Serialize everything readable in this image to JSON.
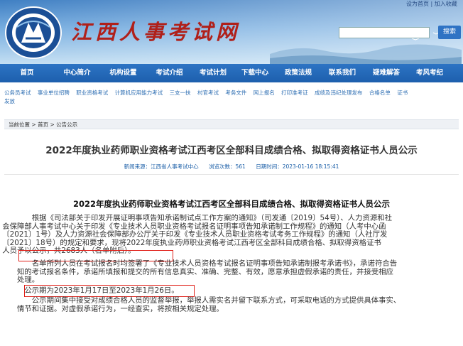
{
  "header": {
    "site_title": "江西人事考试网",
    "top_links": [
      "设为首页",
      "|",
      "加入收藏"
    ],
    "search": {
      "placeholder": "",
      "button_label": "搜索"
    }
  },
  "nav": {
    "items": [
      "首页",
      "中心简介",
      "机构设置",
      "考试介绍",
      "考试计划",
      "下载中心",
      "政策法规",
      "联系我们",
      "疑难解答",
      "考风考纪"
    ]
  },
  "subnav": {
    "items": [
      "公务员考试",
      "事业单位招聘",
      "职业资格考试",
      "计算机应用能力考试",
      "三支一扶",
      "村官考试",
      "考务文件",
      "网上报名",
      "打印准考证",
      "成绩及违纪处理发布",
      "合格名单",
      "证书",
      "发放"
    ]
  },
  "breadcrumb": {
    "prefix": "当前位置",
    "items": [
      "首页",
      "公告公示"
    ],
    "separator": ">"
  },
  "article": {
    "title": "2022年度执业药师职业资格考试江西考区全部科目成绩合格、拟取得资格证书人员公示",
    "meta": {
      "source": "新闻来源：江西省人事考试中心",
      "views": "浏览次数：561",
      "date": "日期时间：2023-01-16 18:15:41"
    },
    "content_title": "2022年度执业药师职业资格考试江西考区全部科目成绩合格、拟取得资格证书人员公示",
    "p1_lines": [
      "根据《司法部关于印发开展证明事项告知承诺制试点工作方案的通知》（司发通〔2019〕54号）、人力资源和社",
      "会保障部人事考试中心关于印发《专业技术人员职业资格考试报名证明事项告知承诺制工作规程》的通知（人考中心函",
      "〔2021〕1号）及人力资源社会保障部办公厅关于印发《专业技术人员职业资格考试考务工作规程》的通知（人社厅发",
      "〔2021〕18号）的规定和要求，现将2022年度执业药师职业资格考试江西考区全部科目成绩合格、拟取得资格证书",
      "人员予以公示，共2683人（名单附后）。"
    ],
    "p2_lines": [
      "名单所列人员在考试报名时均签署了《专业技术人员资格考试报名证明事项告知承诺制报考承诺书》，承诺符合告",
      "知的考试报名条件，承诺所填报和提交的所有信息真实、准确、完整、有效，愿意承担虚假承诺的责任，并接受相应",
      "处理。"
    ],
    "notice_period": "公示期为2023年1月17日至2023年1月26日。",
    "p3_lines": [
      "公示期间集中接受对成绩合格人员的监督举报，举报人需实名并留下联系方式，可采取电话的方式提供具体事实、",
      "情节和证据。对虚假承诺行为，一经查实，将按相关规定处理。"
    ]
  },
  "colors": {
    "nav_bg": "#1d5fad",
    "title_red": "#b0201a",
    "highlight_box": "#e0211a",
    "link_blue": "#2f6fb3"
  }
}
